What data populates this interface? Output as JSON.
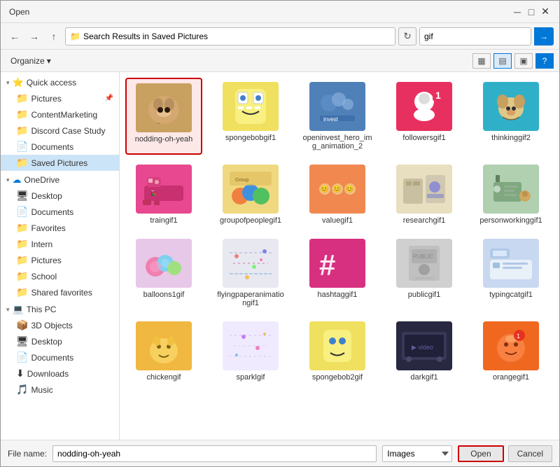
{
  "titleBar": {
    "title": "Open"
  },
  "addressBar": {
    "path": "Search Results in Saved Pictures",
    "searchValue": "gif"
  },
  "toolbar": {
    "organize": "Organize",
    "organizeArrow": "▾"
  },
  "sidebar": {
    "quickAccess": {
      "label": "Quick access",
      "items": [
        {
          "name": "sidebar-pictures",
          "label": "Pictures",
          "pinned": true
        },
        {
          "name": "sidebar-content-marketing",
          "label": "ContentMarketing",
          "pinned": false
        },
        {
          "name": "sidebar-discord",
          "label": "Discord Case Study",
          "pinned": false
        },
        {
          "name": "sidebar-documents",
          "label": "Documents",
          "pinned": false
        },
        {
          "name": "sidebar-saved-pictures",
          "label": "Saved Pictures",
          "pinned": false,
          "active": true
        }
      ]
    },
    "oneDrive": {
      "label": "OneDrive",
      "items": [
        {
          "name": "sidebar-desktop",
          "label": "Desktop"
        },
        {
          "name": "sidebar-documents2",
          "label": "Documents"
        },
        {
          "name": "sidebar-favorites",
          "label": "Favorites"
        },
        {
          "name": "sidebar-intern",
          "label": "Intern"
        },
        {
          "name": "sidebar-pictures2",
          "label": "Pictures"
        },
        {
          "name": "sidebar-school",
          "label": "School"
        },
        {
          "name": "sidebar-shared",
          "label": "Shared favorites"
        }
      ]
    },
    "thisPC": {
      "label": "This PC",
      "items": [
        {
          "name": "sidebar-3d",
          "label": "3D Objects"
        },
        {
          "name": "sidebar-desktop2",
          "label": "Desktop"
        },
        {
          "name": "sidebar-documents3",
          "label": "Documents"
        },
        {
          "name": "sidebar-downloads",
          "label": "Downloads"
        },
        {
          "name": "sidebar-music",
          "label": "Music"
        }
      ]
    }
  },
  "files": [
    {
      "id": "f1",
      "name": "nodding-oh-yeah",
      "thumb": "cat",
      "selected": true
    },
    {
      "id": "f2",
      "name": "spongebobgif1",
      "thumb": "sponge"
    },
    {
      "id": "f3",
      "name": "openinvest_hero_img_animation_2",
      "thumb": "blue"
    },
    {
      "id": "f4",
      "name": "followersgif1",
      "thumb": "pink"
    },
    {
      "id": "f5",
      "name": "thinkinggif2",
      "thumb": "dog"
    },
    {
      "id": "f6",
      "name": "traingif1",
      "thumb": "pink2"
    },
    {
      "id": "f7",
      "name": "groupofpeoplegif1",
      "thumb": "people2"
    },
    {
      "id": "f8",
      "name": "valuegif1",
      "thumb": "value"
    },
    {
      "id": "f9",
      "name": "researchgif1",
      "thumb": "research"
    },
    {
      "id": "f10",
      "name": "personworkinggif1",
      "thumb": "work"
    },
    {
      "id": "f11",
      "name": "balloons1gif",
      "thumb": "balloons"
    },
    {
      "id": "f12",
      "name": "flyingpaperanimationgif1",
      "thumb": "confetti"
    },
    {
      "id": "f13",
      "name": "hashtaggif1",
      "thumb": "hashtag"
    },
    {
      "id": "f14",
      "name": "publicgif1",
      "thumb": "public"
    },
    {
      "id": "f15",
      "name": "typingcatgif1",
      "thumb": "typing"
    },
    {
      "id": "f16",
      "name": "chickengif",
      "thumb": "chicken"
    },
    {
      "id": "f17",
      "name": "sparklgif",
      "thumb": "sparkle"
    },
    {
      "id": "f18",
      "name": "spongebob2gif",
      "thumb": "sponge2"
    },
    {
      "id": "f19",
      "name": "darkgif1",
      "thumb": "dark"
    },
    {
      "id": "f20",
      "name": "orangegif1",
      "thumb": "orange"
    }
  ],
  "bottomBar": {
    "fileNameLabel": "File name:",
    "fileNameValue": "nodding-oh-yeah",
    "fileType": "Images",
    "openBtn": "Open",
    "cancelBtn": "Cancel"
  },
  "icons": {
    "back": "←",
    "forward": "→",
    "up": "↑",
    "refresh": "↻",
    "search": "🔍",
    "chevronDown": "▾",
    "chevronRight": "›",
    "folder": "📁",
    "folderBlue": "📂",
    "star": "⭐",
    "views": "▦",
    "list": "≡",
    "help": "?",
    "close": "✕",
    "minimize": "─",
    "maximize": "□"
  }
}
